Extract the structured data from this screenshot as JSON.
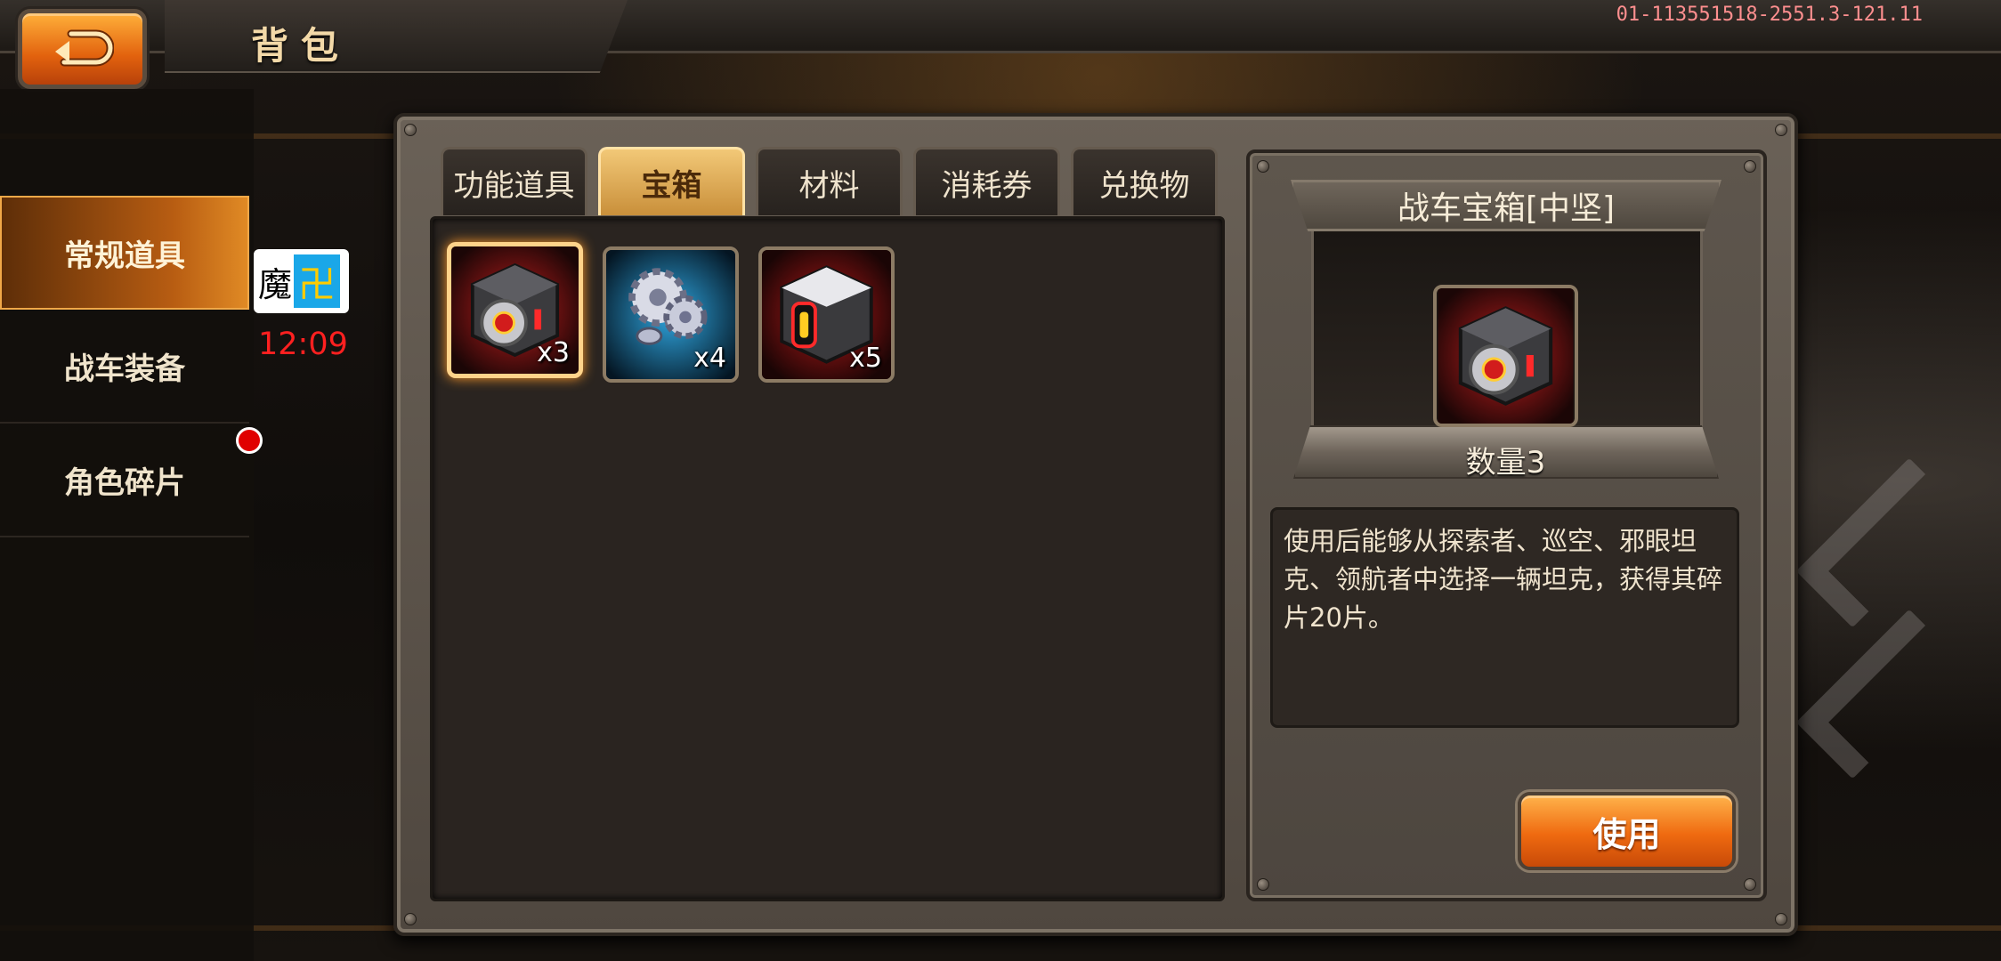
{
  "header": {
    "title": "背包",
    "version": "01-113551518-2551.3-121.11"
  },
  "sidebar": {
    "items": [
      {
        "label": "常规道具",
        "active": true
      },
      {
        "label": "战车装备",
        "active": false
      },
      {
        "label": "角色碎片",
        "active": false,
        "notification": true
      }
    ]
  },
  "overlay": {
    "char": "魔",
    "icon_char": "卍",
    "time": "12:09"
  },
  "tabs": [
    {
      "label": "功能道具",
      "active": false
    },
    {
      "label": "宝箱",
      "active": true
    },
    {
      "label": "材料",
      "active": false
    },
    {
      "label": "消耗券",
      "active": false
    },
    {
      "label": "兑换物",
      "active": false
    }
  ],
  "items": [
    {
      "name": "战车宝箱[中坚]",
      "icon": "red-core-chest-icon",
      "count": "x3",
      "selected": true
    },
    {
      "name": "gears",
      "icon": "gears-icon",
      "count": "x4",
      "selected": false
    },
    {
      "name": "chest",
      "icon": "gold-core-chest-icon",
      "count": "x5",
      "selected": false
    }
  ],
  "detail": {
    "title": "战车宝箱[中坚]",
    "quantity": "数量3",
    "description": "使用后能够从探索者、巡空、邪眼坦克、领航者中选择一辆坦克，获得其碎片20片。",
    "use_button": "使用"
  },
  "colors": {
    "accent": "#ef6a10",
    "tab_active": "#f2c877",
    "notification": "#e00000",
    "time": "#ff2020"
  }
}
